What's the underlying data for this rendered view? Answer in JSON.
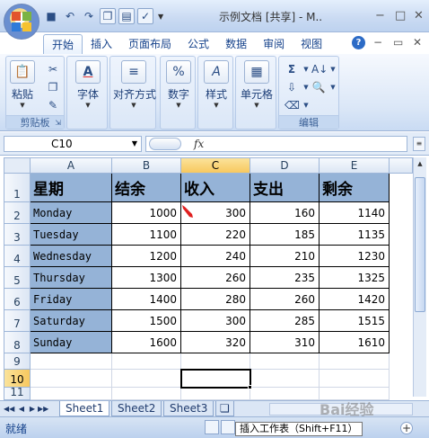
{
  "title_bar": {
    "title": "示例文档  [共享] - M..",
    "minimize": "−",
    "restore": "□",
    "close": "✕"
  },
  "ribbon": {
    "tabs": [
      "开始",
      "插入",
      "页面布局",
      "公式",
      "数据",
      "审阅",
      "视图"
    ],
    "active_tab": "开始",
    "groups": {
      "clipboard": {
        "label": "剪贴板",
        "paste": "粘贴"
      },
      "font": {
        "label": "字体"
      },
      "alignment": {
        "label": "对齐方式"
      },
      "number": {
        "label": "数字"
      },
      "styles": {
        "label": "样式"
      },
      "cells": {
        "label": "单元格"
      },
      "editing": {
        "label": "编辑"
      }
    }
  },
  "formula_bar": {
    "name_box": "C10",
    "fx": "fx",
    "content": ""
  },
  "columns": [
    "A",
    "B",
    "C",
    "D",
    "E"
  ],
  "selected_column": "C",
  "rows": [
    "1",
    "2",
    "3",
    "4",
    "5",
    "6",
    "7",
    "8",
    "9",
    "10",
    "11"
  ],
  "selected_row": "10",
  "table": {
    "headers": [
      "星期",
      "结余",
      "收入",
      "支出",
      "剩余"
    ],
    "data": [
      [
        "Monday",
        "1000",
        "300",
        "160",
        "1140"
      ],
      [
        "Tuesday",
        "1100",
        "220",
        "185",
        "1135"
      ],
      [
        "Wednesday",
        "1200",
        "240",
        "210",
        "1230"
      ],
      [
        "Thursday",
        "1300",
        "260",
        "235",
        "1325"
      ],
      [
        "Friday",
        "1400",
        "280",
        "260",
        "1420"
      ],
      [
        "Saturday",
        "1500",
        "300",
        "285",
        "1515"
      ],
      [
        "Sunday",
        "1600",
        "320",
        "310",
        "1610"
      ]
    ]
  },
  "sheet_tabs": [
    "Sheet1",
    "Sheet2",
    "Sheet3"
  ],
  "active_sheet": "Sheet1",
  "tooltip": "插入工作表（Shift+F11）",
  "status_bar": {
    "status": "就绪"
  },
  "watermark": "Bai经验",
  "colors": {
    "header_fill": "#95b3d7",
    "selection_highlight": "#f7c85e",
    "ribbon_text": "#15428b",
    "annotation_arrow": "#e02020"
  }
}
